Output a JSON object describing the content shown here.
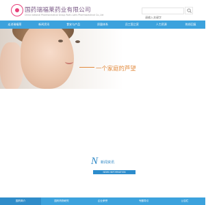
{
  "header": {
    "company_cn": "国药瑞福莱药业有限公司",
    "company_en": "China national Pharmaceutical Group Ruifu Laifu Pharmaceutical Co.,Ltd",
    "search_placeholder": "请输入关键字"
  },
  "nav": {
    "items": [
      "走进瑞福莱",
      "新闻资讯",
      "食安与产品",
      "质量体系",
      "员工国之家",
      "人力资源",
      "热线回复"
    ]
  },
  "hero": {
    "slogan": "一个家庭的芦望"
  },
  "news": {
    "big_letter": "N",
    "title_cn": "新闻资讯",
    "title_en": "NEWS INFORMATION"
  },
  "footer": {
    "items": [
      "国药简介",
      "国药药物研究",
      "企业荣誉",
      "专题导引",
      "公告栏"
    ],
    "active_index": 0
  },
  "colors": {
    "nav_bg": "#3ca2dd",
    "slogan": "#e2893c",
    "brand_text": "#7a5a86",
    "news_blue": "#2c8ccc"
  }
}
